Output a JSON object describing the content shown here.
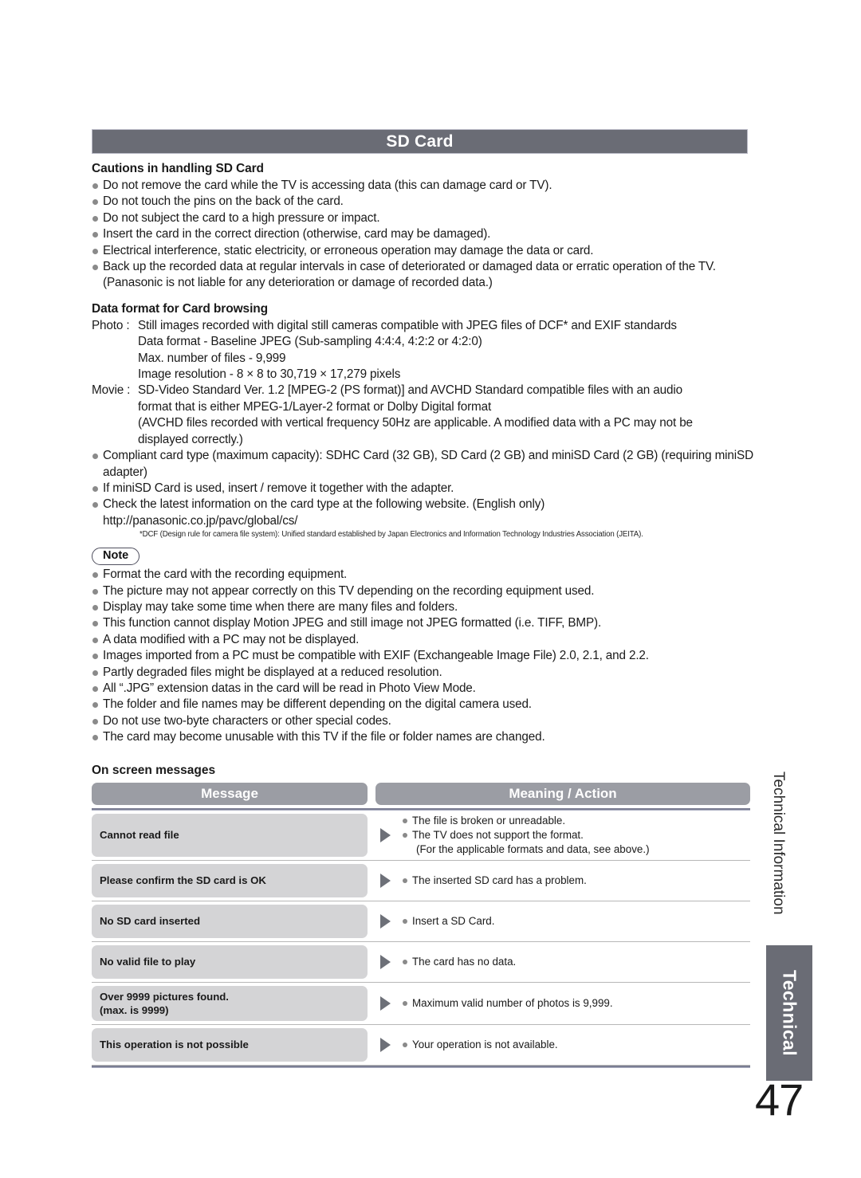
{
  "page": {
    "number": "47",
    "banner_color": "#6a6c75",
    "row_cell_color": "#d4d4d6",
    "header_cell_color": "#9b9da4",
    "bullet_color": "#8a8a8a"
  },
  "title": "SD Card",
  "sections": {
    "cautions": {
      "heading": "Cautions in handling SD Card",
      "bullets": [
        "Do not remove the card while the TV is accessing data (this can damage card or TV).",
        "Do not touch the pins on the back of the card.",
        "Do not subject the card to a high pressure or impact.",
        "Insert the card in the correct direction (otherwise, card may be damaged).",
        "Electrical interference, static electricity, or erroneous operation may damage the data or card.",
        "Back up the recorded data at regular intervals in case of deteriorated or damaged data or erratic operation of the TV. (Panasonic is not liable for any deterioration or damage of recorded data.)"
      ]
    },
    "data_format": {
      "heading": "Data format for Card browsing",
      "photo": {
        "label": "Photo :",
        "main": "Still images recorded with digital still cameras compatible with JPEG files of DCF* and EXIF standards",
        "lines": [
          "Data format - Baseline JPEG (Sub-sampling 4:4:4, 4:2:2 or 4:2:0)",
          "Max. number of files - 9,999",
          "Image resolution - 8 × 8 to 30,719 × 17,279 pixels"
        ]
      },
      "movie": {
        "label": "Movie :",
        "main": "SD-Video Standard Ver. 1.2 [MPEG-2 (PS format)] and AVCHD Standard compatible files with an audio",
        "lines": [
          "format that is either MPEG-1/Layer-2 format or Dolby Digital format",
          "(AVCHD files recorded with vertical frequency 50Hz are applicable. A modified data with a PC may not be",
          "displayed correctly.)"
        ]
      },
      "bullets": [
        "Compliant card type (maximum capacity): SDHC Card (32 GB), SD Card (2 GB) and miniSD Card (2 GB) (requiring miniSD adapter)",
        "If miniSD Card is used, insert / remove it together with the adapter.",
        "Check the latest information on the card type at the following website. (English only)"
      ],
      "website": "http://panasonic.co.jp/pavc/global/cs/",
      "footnote": "*DCF (Design rule for camera file system): Unified standard established by Japan Electronics and Information Technology Industries Association (JEITA)."
    },
    "note": {
      "badge": "Note",
      "bullets": [
        "Format the card with the recording equipment.",
        "The picture may not appear correctly on this TV depending on the recording equipment used.",
        "Display may take some time when there are many files and folders.",
        "This function cannot display Motion JPEG and still image not JPEG formatted (i.e. TIFF, BMP).",
        "A data modified with a PC may not be displayed.",
        "Images imported from a PC must be compatible with EXIF (Exchangeable Image File) 2.0, 2.1, and 2.2.",
        "Partly degraded files might be displayed at a reduced resolution.",
        "All “.JPG” extension datas in the card will be read in Photo View Mode.",
        "The folder and file names may be different depending on the digital camera used.",
        "Do not use two-byte characters or other special codes.",
        "The card may become unusable with this TV if the file or folder names are changed."
      ]
    },
    "on_screen_messages": {
      "heading": "On screen messages",
      "columns": [
        "Message",
        "Meaning / Action"
      ],
      "rows": [
        {
          "message": "Cannot read file",
          "message_line2": "",
          "meanings": [
            "The file is broken or unreadable.",
            "The TV does not support the format."
          ],
          "extra": "(For the applicable formats and data, see above.)"
        },
        {
          "message": "Please confirm the SD card is OK",
          "message_line2": "",
          "meanings": [
            "The inserted SD card has a problem."
          ],
          "extra": ""
        },
        {
          "message": "No SD card inserted",
          "message_line2": "",
          "meanings": [
            "Insert a SD Card."
          ],
          "extra": ""
        },
        {
          "message": "No valid file to play",
          "message_line2": "",
          "meanings": [
            "The card has no data."
          ],
          "extra": ""
        },
        {
          "message": "Over 9999 pictures found.",
          "message_line2": "(max. is 9999)",
          "meanings": [
            "Maximum valid number of photos is 9,999."
          ],
          "extra": ""
        },
        {
          "message": "This operation is not possible",
          "message_line2": "",
          "meanings": [
            "Your operation is not available."
          ],
          "extra": ""
        }
      ]
    }
  },
  "side": {
    "vertical_label": "Technical Information",
    "tab_label": "Technical"
  }
}
